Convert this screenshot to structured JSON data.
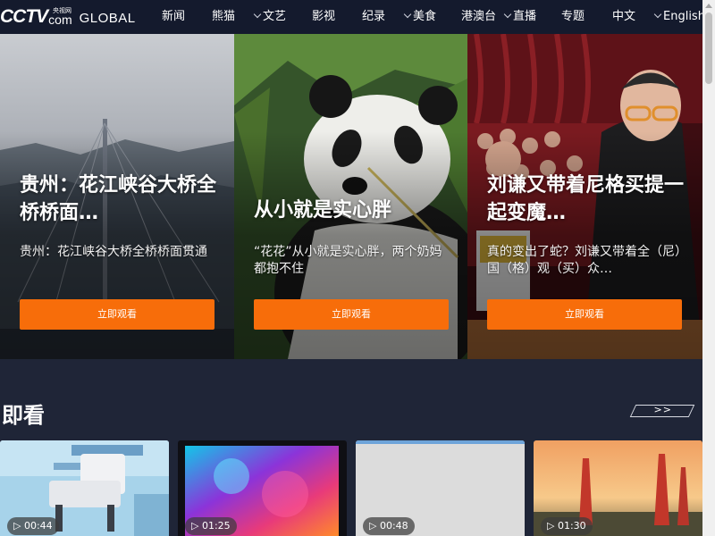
{
  "logo": {
    "brand": "CCTV",
    "suffix": "com",
    "chinese": "央视网",
    "global": "GLOBAL"
  },
  "nav": {
    "items": [
      {
        "label": "新闻"
      },
      {
        "label": "熊猫"
      },
      {
        "label": "文艺",
        "dropdown": true
      },
      {
        "label": "影视"
      },
      {
        "label": "纪录"
      },
      {
        "label": "美食",
        "dropdown": true
      },
      {
        "label": "港澳台"
      },
      {
        "label": "直播",
        "dropdown": true
      },
      {
        "label": "专题"
      },
      {
        "label": "中文"
      },
      {
        "label": "English",
        "dropdown": true
      }
    ]
  },
  "hero": [
    {
      "title": "贵州：花江峡谷大桥全桥桥面…",
      "desc": "贵州：花江峡谷大桥全桥桥面贯通",
      "button": "立即观看",
      "image": "bridge-in-fog"
    },
    {
      "title": "从小就是实心胖",
      "desc": "“花花”从小就是实心胖，两个奶妈都抱不住",
      "button": "立即观看",
      "image": "giant-panda"
    },
    {
      "title": "刘谦又带着尼格买提一起变魔…",
      "desc": "真的变出了蛇？刘谦又带着全（尼）国（格）观（买）众…",
      "button": "立即观看",
      "image": "magician-on-stage"
    }
  ],
  "section": {
    "title": "即看",
    "more": ">>"
  },
  "videos": [
    {
      "duration": "00:44",
      "image": "robot-dog"
    },
    {
      "duration": "01:25",
      "image": "colorful-screen"
    },
    {
      "duration": "00:48",
      "image": "blank-placeholder"
    },
    {
      "duration": "01:30",
      "image": "oil-derricks-sunset"
    }
  ],
  "colors": {
    "nav_bg": "#141a2d",
    "page_bg": "#1f2537",
    "accent": "#f76d0a"
  }
}
